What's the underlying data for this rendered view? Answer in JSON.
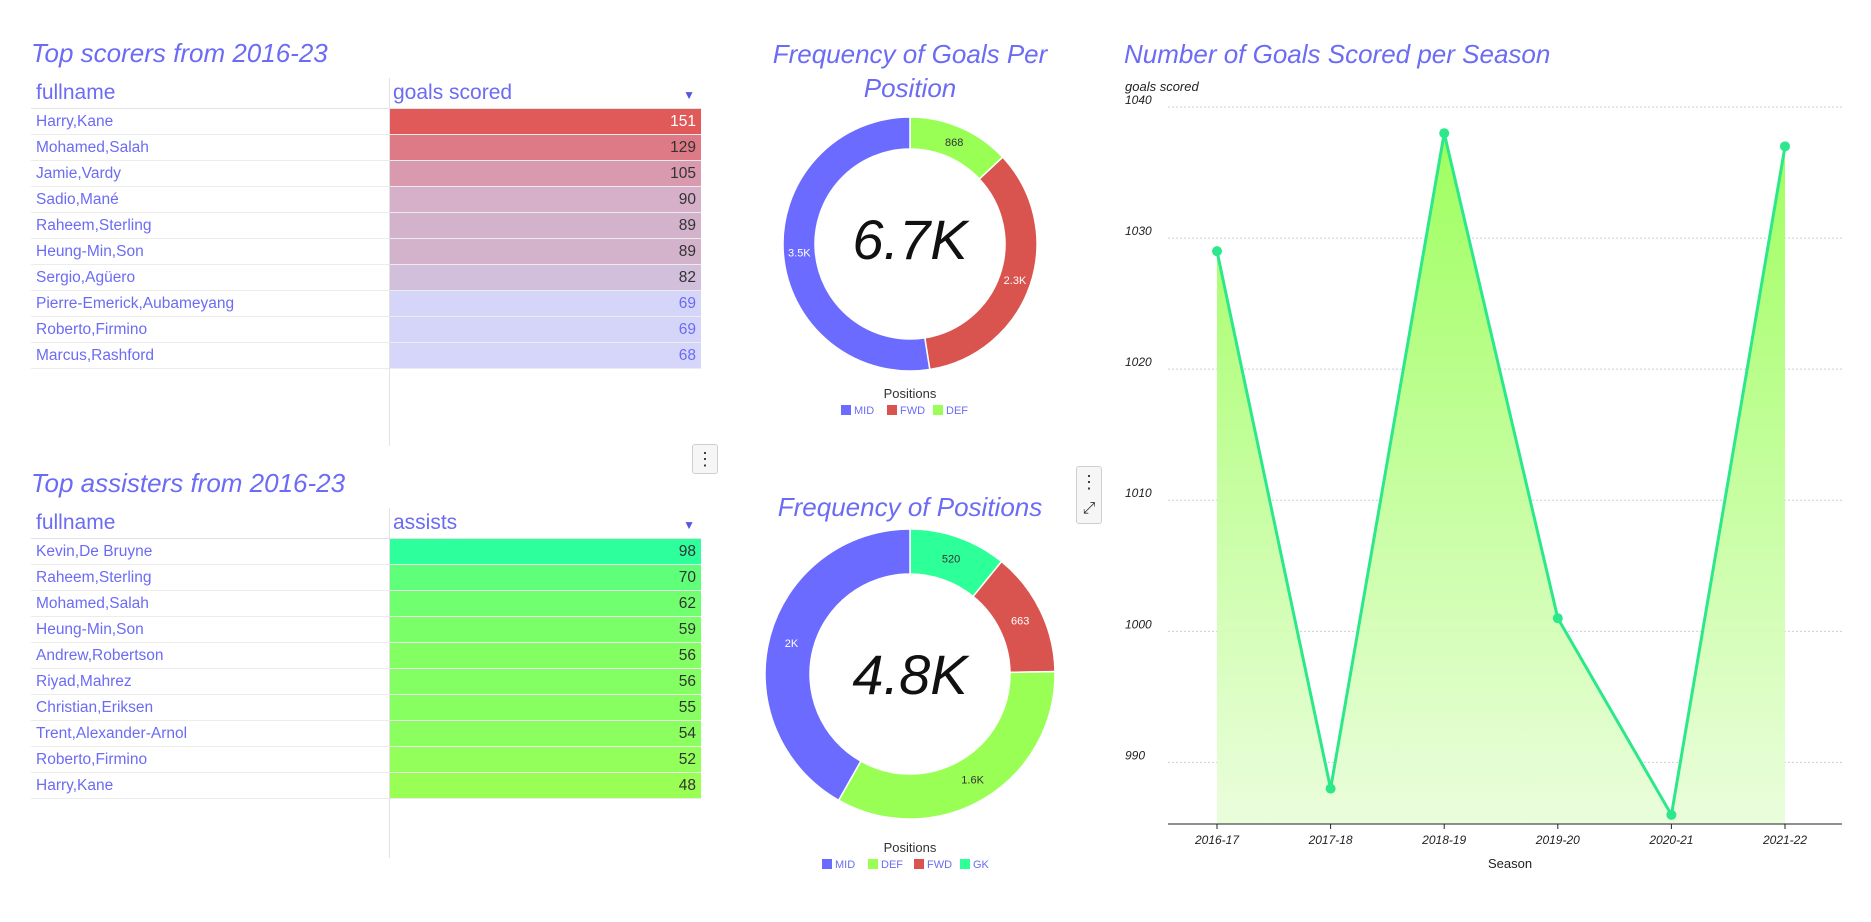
{
  "colors": {
    "accent": "#6b6bf5",
    "mid": "#6b6bff",
    "fwd": "#d9534f",
    "def": "#99ff55",
    "gk": "#2dff99",
    "line": "#2de88a"
  },
  "scorers": {
    "title": "Top scorers from 2016-23",
    "col_name": "fullname",
    "col_value": "goals scored",
    "sort_icon": "▼",
    "rows": [
      {
        "name": "Harry,Kane",
        "value": 151,
        "bg": "#e05a5a",
        "fg": "#ffffff"
      },
      {
        "name": "Mohamed,Salah",
        "value": 129,
        "bg": "#dd7a86",
        "fg": "#333333"
      },
      {
        "name": "Jamie,Vardy",
        "value": 105,
        "bg": "#d99aaf",
        "fg": "#333333"
      },
      {
        "name": "Sadio,Mané",
        "value": 90,
        "bg": "#d5b0c8",
        "fg": "#333333"
      },
      {
        "name": "Raheem,Sterling",
        "value": 89,
        "bg": "#d3b3cc",
        "fg": "#333333"
      },
      {
        "name": "Heung-Min,Son",
        "value": 89,
        "bg": "#d3b3cc",
        "fg": "#333333"
      },
      {
        "name": "Sergio,Agüero",
        "value": 82,
        "bg": "#d2bfdc",
        "fg": "#333333"
      },
      {
        "name": "Pierre-Emerick,Aubameyang",
        "value": 69,
        "bg": "#d5d5fa",
        "fg": "#6b6bf5"
      },
      {
        "name": "Roberto,Firmino",
        "value": 69,
        "bg": "#d5d5fa",
        "fg": "#6b6bf5"
      },
      {
        "name": "Marcus,Rashford",
        "value": 68,
        "bg": "#d6d6fb",
        "fg": "#6b6bf5"
      }
    ]
  },
  "assisters": {
    "title": "Top assisters from 2016-23",
    "col_name": "fullname",
    "col_value": "assists",
    "sort_icon": "▼",
    "rows": [
      {
        "name": "Kevin,De Bruyne",
        "value": 98,
        "bg": "#2dff9c",
        "fg": "#333333"
      },
      {
        "name": "Raheem,Sterling",
        "value": 70,
        "bg": "#5fff7a",
        "fg": "#333333"
      },
      {
        "name": "Mohamed,Salah",
        "value": 62,
        "bg": "#70ff6f",
        "fg": "#333333"
      },
      {
        "name": "Heung-Min,Son",
        "value": 59,
        "bg": "#7aff69",
        "fg": "#333333"
      },
      {
        "name": "Andrew,Robertson",
        "value": 56,
        "bg": "#84ff63",
        "fg": "#333333"
      },
      {
        "name": "Riyad,Mahrez",
        "value": 56,
        "bg": "#84ff63",
        "fg": "#333333"
      },
      {
        "name": "Christian,Eriksen",
        "value": 55,
        "bg": "#88ff61",
        "fg": "#333333"
      },
      {
        "name": "Trent,Alexander-Arnol",
        "value": 54,
        "bg": "#8bff5f",
        "fg": "#333333"
      },
      {
        "name": "Roberto,Firmino",
        "value": 52,
        "bg": "#92ff5b",
        "fg": "#333333"
      },
      {
        "name": "Harry,Kane",
        "value": 48,
        "bg": "#99ff55",
        "fg": "#333333"
      }
    ]
  },
  "menu": {
    "dots_icon": "⋮",
    "expand_icon": "⤢"
  },
  "chart_data": [
    {
      "type": "pie",
      "title": "Frequency of Goals Per Position",
      "center_label": "6.7K",
      "legend_title": "Positions",
      "legend_position": "bottom",
      "slices": [
        {
          "label": "MID",
          "value": 3500,
          "display": "3.5K",
          "color": "#6b6bff"
        },
        {
          "label": "FWD",
          "value": 2300,
          "display": "2.3K",
          "color": "#d9534f"
        },
        {
          "label": "DEF",
          "value": 868,
          "display": "868",
          "color": "#99ff55"
        }
      ],
      "start_order": [
        "DEF",
        "FWD",
        "MID"
      ]
    },
    {
      "type": "pie",
      "title": "Frequency of Positions",
      "center_label": "4.8K",
      "legend_title": "Positions",
      "legend_position": "bottom",
      "slices": [
        {
          "label": "MID",
          "value": 2000,
          "display": "2K",
          "color": "#6b6bff"
        },
        {
          "label": "DEF",
          "value": 1600,
          "display": "1.6K",
          "color": "#99ff55"
        },
        {
          "label": "FWD",
          "value": 663,
          "display": "663",
          "color": "#d9534f"
        },
        {
          "label": "GK",
          "value": 520,
          "display": "520",
          "color": "#2dff99"
        }
      ],
      "start_order": [
        "GK",
        "FWD",
        "DEF",
        "MID"
      ]
    },
    {
      "type": "area",
      "title": "Number of Goals Scored per Season",
      "xlabel": "Season",
      "ylabel": "goals scored",
      "categories": [
        "2016-17",
        "2017-18",
        "2018-19",
        "2019-20",
        "2020-21",
        "2021-22"
      ],
      "values": [
        1029,
        988,
        1038,
        1001,
        986,
        1037
      ],
      "yticks": [
        990,
        1000,
        1010,
        1020,
        1030,
        1040
      ],
      "ylim": [
        985.3,
        1040
      ],
      "grid": true
    }
  ]
}
